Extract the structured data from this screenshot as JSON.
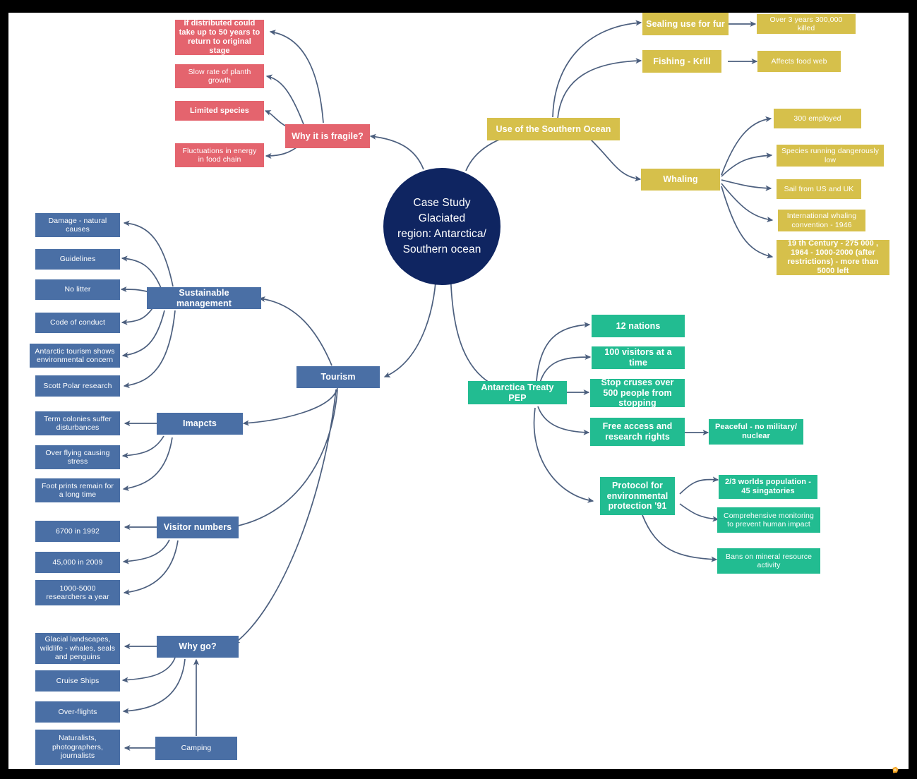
{
  "diagram": {
    "title": "Case Study  Glaciated region: Antarctica/ Southern ocean",
    "type": "mind-map",
    "colors": {
      "center": "#0f2561",
      "blue": "#4a6fa5",
      "pink": "#e4646e",
      "yellow": "#d6c04b",
      "teal": "#22bc91",
      "connector": "#4c5f7e",
      "frame": "#000000",
      "canvas": "#ffffff",
      "logo": "#f5a623"
    }
  },
  "center": {
    "label": "Case Study  Glaciated region: Antarctica/ Southern ocean",
    "line1": "Case Study  Glaciated",
    "line2": "region: Antarctica/",
    "line3": "Southern ocean"
  },
  "branches": {
    "fragile": {
      "label": "Why it is fragile?",
      "color": "#e4646e",
      "children": [
        {
          "label": "If distributed could take up to 50 years to return to original stage"
        },
        {
          "label": "Slow rate of planth growth"
        },
        {
          "label": "Limited species"
        },
        {
          "label": "Fluctuations in energy in food chain"
        }
      ]
    },
    "southern_ocean": {
      "label": "Use of the Southern Ocean",
      "color": "#d6c04b",
      "children": [
        {
          "label": "Sealing use for fur",
          "children": [
            {
              "label": "Over 3 years 300,000 killed"
            }
          ]
        },
        {
          "label": "Fishing - Krill",
          "children": [
            {
              "label": "Affects food web"
            }
          ]
        },
        {
          "label": "Whaling",
          "children": [
            {
              "label": "300 employed"
            },
            {
              "label": "Species running dangerously low"
            },
            {
              "label": "Sail from US and UK"
            },
            {
              "label": "International whaling convention - 1946"
            },
            {
              "label": "19 th Century - 275 000 , 1964 - 1000-2000 (after restrictions) - more than 5000 left"
            }
          ]
        }
      ]
    },
    "treaty": {
      "label": "Antarctica Treaty PEP",
      "color": "#22bc91",
      "children": [
        {
          "label": "12 nations"
        },
        {
          "label": "100 visitors at a time"
        },
        {
          "label": "Stop cruses over 500 people from stopping"
        },
        {
          "label": "Free access and research rights",
          "children": [
            {
              "label": "Peaceful - no military/ nuclear"
            }
          ]
        },
        {
          "label": "Protocol for environmental protection '91",
          "children": [
            {
              "label": "2/3 worlds population - 45 singatories"
            },
            {
              "label": "Comprehensive monitoring to prevent human impact"
            },
            {
              "label": "Bans on mineral resource activity"
            }
          ]
        }
      ]
    },
    "tourism": {
      "label": "Tourism",
      "color": "#4a6fa5",
      "children": [
        {
          "label": "Sustainable management",
          "children": [
            {
              "label": "Damage - natural causes"
            },
            {
              "label": "Guidelines"
            },
            {
              "label": "No litter"
            },
            {
              "label": "Code of conduct"
            },
            {
              "label": "Antarctic tourism shows environmental concern"
            },
            {
              "label": "Scott Polar research"
            }
          ]
        },
        {
          "label": "Imapcts",
          "children": [
            {
              "label": "Term colonies suffer disturbances"
            },
            {
              "label": "Over flying causing stress"
            },
            {
              "label": "Foot prints remain for a long time"
            }
          ]
        },
        {
          "label": "Visitor numbers",
          "children": [
            {
              "label": "6700 in 1992"
            },
            {
              "label": "45,000 in 2009"
            },
            {
              "label": "1000-5000 researchers a year"
            }
          ]
        },
        {
          "label": "Why go?",
          "children": [
            {
              "label": "Glacial landscapes, wildlife - whales, seals and penguins"
            },
            {
              "label": "Cruise Ships"
            },
            {
              "label": "Over-flights"
            },
            {
              "label": "Naturalists, photographers, journalists"
            }
          ]
        },
        {
          "label": "Camping",
          "children": [
            {
              "label": "Naturalists, photographers, journalists"
            }
          ]
        }
      ]
    }
  },
  "nodes": {
    "center": "Case Study  Glaciated region: Antarctica/ Southern ocean",
    "fragile_main": "Why it is fragile?",
    "fragile_1": "If distributed could take up to 50 years to return to original stage",
    "fragile_2": "Slow rate of planth growth",
    "fragile_3": "Limited species",
    "fragile_4": "Fluctuations in energy in food chain",
    "so_main": "Use of the Southern Ocean",
    "so_sealing": "Sealing use for fur",
    "so_sealing_1": "Over 3 years 300,000 killed",
    "so_fishing": "Fishing - Krill",
    "so_fishing_1": "Affects food web",
    "so_whaling": "Whaling",
    "so_whaling_1": "300 employed",
    "so_whaling_2": "Species running dangerously low",
    "so_whaling_3": "Sail from US and UK",
    "so_whaling_4": "International whaling convention - 1946",
    "so_whaling_5": "19 th Century - 275 000 , 1964 - 1000-2000 (after restrictions) - more than 5000 left",
    "treaty_main": "Antarctica Treaty PEP",
    "treaty_1": "12 nations",
    "treaty_2": "100 visitors at a time",
    "treaty_3": "Stop cruses over 500 people from stopping",
    "treaty_4": "Free access and research rights",
    "treaty_4_1": "Peaceful - no military/ nuclear",
    "treaty_5": "Protocol for environmental protection '91",
    "treaty_5_1": "2/3 worlds population - 45 singatories",
    "treaty_5_2": "Comprehensive monitoring to prevent human impact",
    "treaty_5_3": "Bans on mineral resource activity",
    "tourism_main": "Tourism",
    "sm_main": "Sustainable management",
    "sm_1": "Damage - natural causes",
    "sm_2": "Guidelines",
    "sm_3": "No litter",
    "sm_4": "Code of conduct",
    "sm_5": "Antarctic tourism shows environmental concern",
    "sm_6": "Scott Polar research",
    "imp_main": "Imapcts",
    "imp_1": "Term colonies suffer disturbances",
    "imp_2": "Over flying causing stress",
    "imp_3": "Foot prints remain for a long time",
    "vn_main": "Visitor numbers",
    "vn_1": "6700 in 1992",
    "vn_2": "45,000 in 2009",
    "vn_3": "1000-5000 researchers a year",
    "wg_main": "Why go?",
    "wg_1": "Glacial landscapes, wildlife - whales, seals and penguins",
    "wg_2": "Cruise Ships",
    "wg_3": "Over-flights",
    "wg_4": "Naturalists, photographers, journalists",
    "camping_main": "Camping"
  }
}
